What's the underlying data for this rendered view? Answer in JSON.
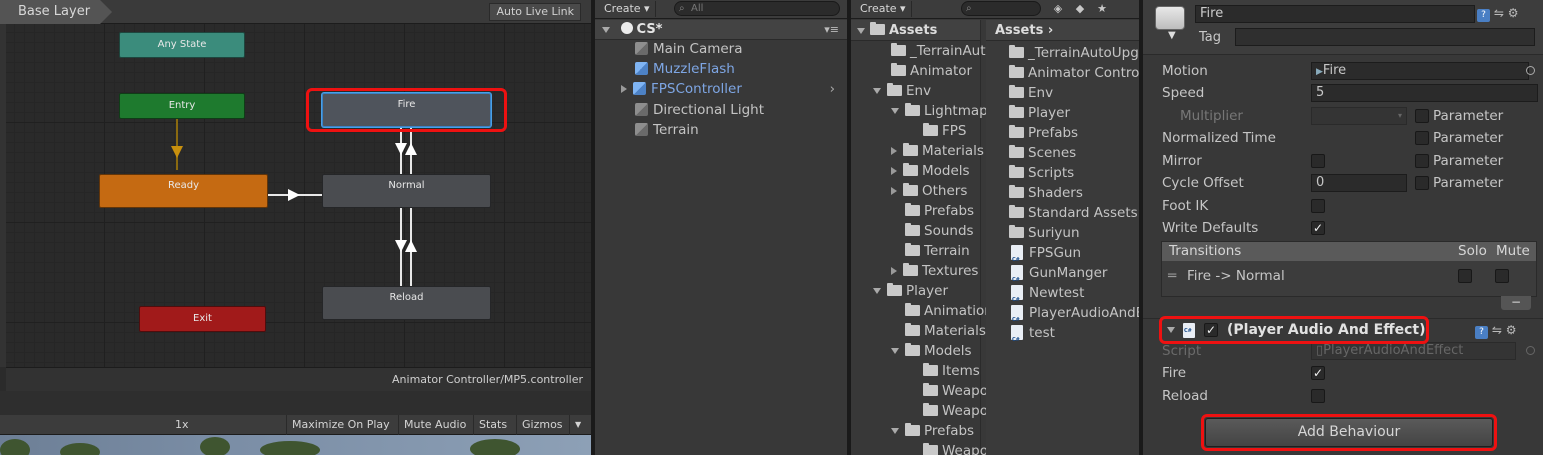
{
  "animator": {
    "layer": "Base Layer",
    "auto_live_link": "Auto Live Link",
    "status_path": "Animator Controller/MP5.controller",
    "states": {
      "any": "Any State",
      "entry": "Entry",
      "exit": "Exit",
      "ready": "Ready",
      "fire": "Fire",
      "normal": "Normal",
      "reload": "Reload"
    },
    "colors": {
      "any": "#3b8c7c",
      "entry": "#1e7a2e",
      "exit": "#a11a1a",
      "ready": "#c56a12",
      "selected_outline": "#4aa0e6",
      "annotation": "#ee1111"
    }
  },
  "gameview": {
    "scale": "1x",
    "maximize_on_play": "Maximize On Play",
    "mute_audio": "Mute Audio",
    "stats": "Stats",
    "gizmos": "Gizmos"
  },
  "hierarchy": {
    "create": "Create",
    "search_placeholder": "All",
    "scene": "CS*",
    "items": [
      {
        "label": "Main Camera",
        "icon": "cube-icon"
      },
      {
        "label": "MuzzleFlash",
        "icon": "prefab-cube-icon"
      },
      {
        "label": "FPSController",
        "icon": "prefab-cube-icon"
      },
      {
        "label": "Directional Light",
        "icon": "cube-icon"
      },
      {
        "label": "Terrain",
        "icon": "cube-icon"
      }
    ]
  },
  "project": {
    "create": "Create",
    "left_root": "Assets",
    "tree": [
      {
        "label": "_TerrainAutoUpgrade"
      },
      {
        "label": "Animator"
      },
      {
        "label": "Env"
      },
      {
        "label": "Lightmaps"
      },
      {
        "label": "FPS"
      },
      {
        "label": "Materials"
      },
      {
        "label": "Models"
      },
      {
        "label": "Others"
      },
      {
        "label": "Prefabs"
      },
      {
        "label": "Sounds"
      },
      {
        "label": "Terrain"
      },
      {
        "label": "Textures"
      },
      {
        "label": "Player"
      },
      {
        "label": "Animations"
      },
      {
        "label": "Materials"
      },
      {
        "label": "Models"
      },
      {
        "label": "Items"
      },
      {
        "label": "Weapons"
      },
      {
        "label": "Weapons"
      },
      {
        "label": "Prefabs"
      },
      {
        "label": "Weapons"
      }
    ],
    "right_root": "Assets",
    "files": [
      {
        "label": "_TerrainAutoUpgrade",
        "type": "folder"
      },
      {
        "label": "Animator Controllers",
        "type": "folder"
      },
      {
        "label": "Env",
        "type": "folder"
      },
      {
        "label": "Player",
        "type": "folder"
      },
      {
        "label": "Prefabs",
        "type": "folder"
      },
      {
        "label": "Scenes",
        "type": "folder"
      },
      {
        "label": "Scripts",
        "type": "folder"
      },
      {
        "label": "Shaders",
        "type": "folder"
      },
      {
        "label": "Standard Assets",
        "type": "folder"
      },
      {
        "label": "Suriyun",
        "type": "folder"
      },
      {
        "label": "FPSGun",
        "type": "script"
      },
      {
        "label": "GunManger",
        "type": "script"
      },
      {
        "label": "Newtest",
        "type": "script"
      },
      {
        "label": "PlayerAudioAndEffect",
        "type": "script"
      },
      {
        "label": "test",
        "type": "script"
      }
    ]
  },
  "inspector": {
    "name": "Fire",
    "tag_label": "Tag",
    "motion_label": "Motion",
    "motion_value": "Fire",
    "speed_label": "Speed",
    "speed_value": "5",
    "multiplier_label": "Multiplier",
    "normalized_time_label": "Normalized Time",
    "mirror_label": "Mirror",
    "cycle_offset_label": "Cycle Offset",
    "cycle_offset_value": "0",
    "foot_ik_label": "Foot IK",
    "write_defaults_label": "Write Defaults",
    "parameter_label": "Parameter",
    "transitions": {
      "header": "Transitions",
      "solo": "Solo",
      "mute": "Mute",
      "rows": [
        {
          "label": "Fire -> Normal"
        }
      ]
    },
    "behaviour": {
      "title": "(Player Audio And Effect)",
      "script_label": "Script",
      "script_value": "PlayerAudioAndEffect",
      "fire_label": "Fire",
      "reload_label": "Reload"
    },
    "add_behaviour": "Add Behaviour",
    "checks": {
      "write_defaults": true,
      "behaviour_enabled": true,
      "fire": true,
      "reload": false,
      "mirror": false,
      "foot_ik": false
    }
  }
}
